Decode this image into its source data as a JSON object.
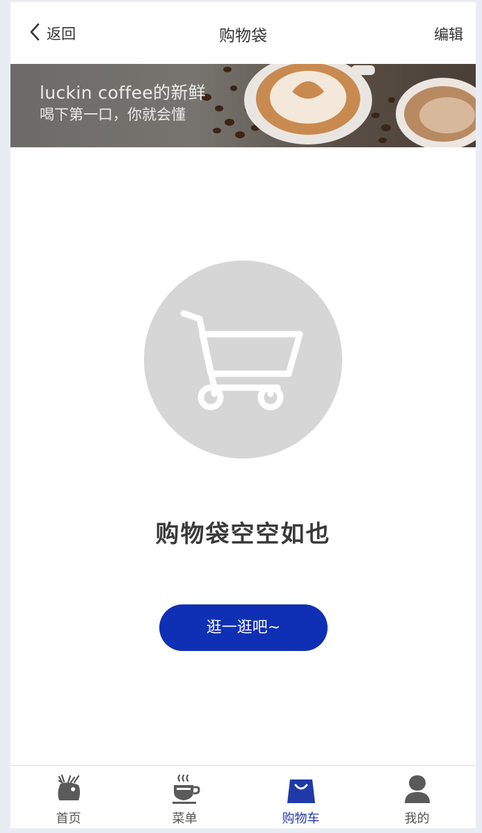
{
  "header": {
    "back_label": "返回",
    "title": "购物袋",
    "edit_label": "编辑"
  },
  "banner": {
    "line1": "luckin coffee的新鲜",
    "line2": "喝下第一口，你就会懂"
  },
  "empty_state": {
    "icon": "shopping-cart-icon",
    "title": "购物袋空空如也",
    "button_label": "逛一逛吧~"
  },
  "tabbar": {
    "tabs": [
      {
        "label": "首页",
        "icon": "deer-logo-icon",
        "active": false
      },
      {
        "label": "菜单",
        "icon": "coffee-cup-icon",
        "active": false
      },
      {
        "label": "购物车",
        "icon": "shopping-bag-icon",
        "active": true
      },
      {
        "label": "我的",
        "icon": "user-icon",
        "active": false
      }
    ]
  },
  "colors": {
    "accent": "#0f2fb5",
    "active_tab": "#1f3aa8",
    "illustration_bg": "#d6d6d6"
  }
}
